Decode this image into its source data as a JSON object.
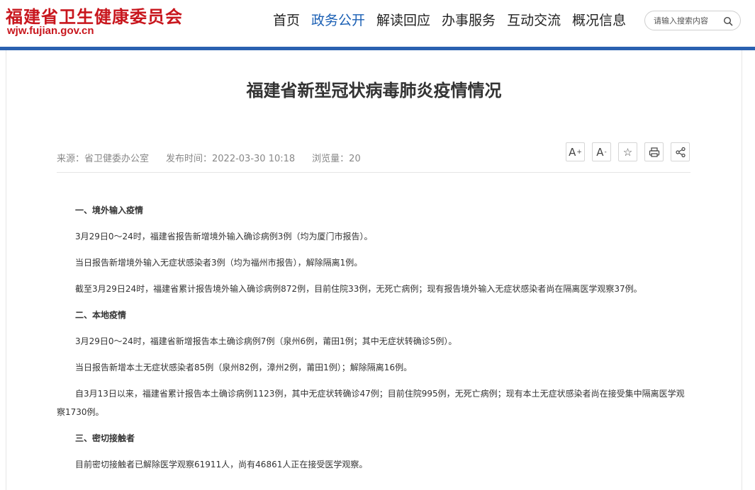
{
  "header": {
    "logo_cn": "福建省卫生健康委员会",
    "logo_url": "wjw.fujian.gov.cn",
    "nav": [
      "首页",
      "政务公开",
      "解读回应",
      "办事服务",
      "互动交流",
      "概况信息"
    ],
    "active_nav": "政务公开",
    "search": {
      "placeholder": "请输入搜索内容",
      "icon": "search-icon"
    }
  },
  "colors": {
    "brand_red": "#c8161d",
    "accent_blue": "#2a61b0",
    "active_nav": "#1a5fb4"
  },
  "article": {
    "title": "福建省新型冠状病毒肺炎疫情情况",
    "meta": {
      "source": "来源：省卫健委办公室",
      "publish_time": "发布时间：2022-03-30 10:18",
      "views": "浏览量：20"
    },
    "tools": [
      {
        "label": "A",
        "sup": "+",
        "icon": "font-increase-icon"
      },
      {
        "label": "A",
        "sup": "-",
        "icon": "font-decrease-icon"
      },
      {
        "label": "☆",
        "icon": "star-icon"
      },
      {
        "label": "",
        "icon": "print-icon"
      },
      {
        "label": "",
        "icon": "share-icon"
      }
    ],
    "paragraphs": [
      {
        "type": "heading",
        "text": "一、境外输入疫情"
      },
      {
        "type": "text",
        "text": "3月29日0～24时，福建省报告新增境外输入确诊病例3例（均为厦门市报告）。"
      },
      {
        "type": "text",
        "text": "当日报告新增境外输入无症状感染者3例（均为福州市报告），解除隔离1例。"
      },
      {
        "type": "text",
        "text": "截至3月29日24时，福建省累计报告境外输入确诊病例872例，目前住院33例，无死亡病例；现有报告境外输入无症状感染者尚在隔离医学观察37例。"
      },
      {
        "type": "heading",
        "text": "二、本地疫情"
      },
      {
        "type": "text",
        "text": "3月29日0～24时，福建省新增报告本土确诊病例7例（泉州6例，莆田1例；其中无症状转确诊5例）。"
      },
      {
        "type": "text",
        "text": "当日报告新增本土无症状感染者85例（泉州82例，漳州2例，莆田1例）；解除隔离16例。"
      },
      {
        "type": "text",
        "text": "自3月13日以来，福建省累计报告本土确诊病例1123例，其中无症状转确诊47例；目前住院995例，无死亡病例；现有本土无症状感染者尚在接受集中隔离医学观察1730例。"
      },
      {
        "type": "heading",
        "text": "三、密切接触者"
      },
      {
        "type": "text",
        "text": "目前密切接触者已解除医学观察61911人，尚有46861人正在接受医学观察。"
      }
    ]
  }
}
